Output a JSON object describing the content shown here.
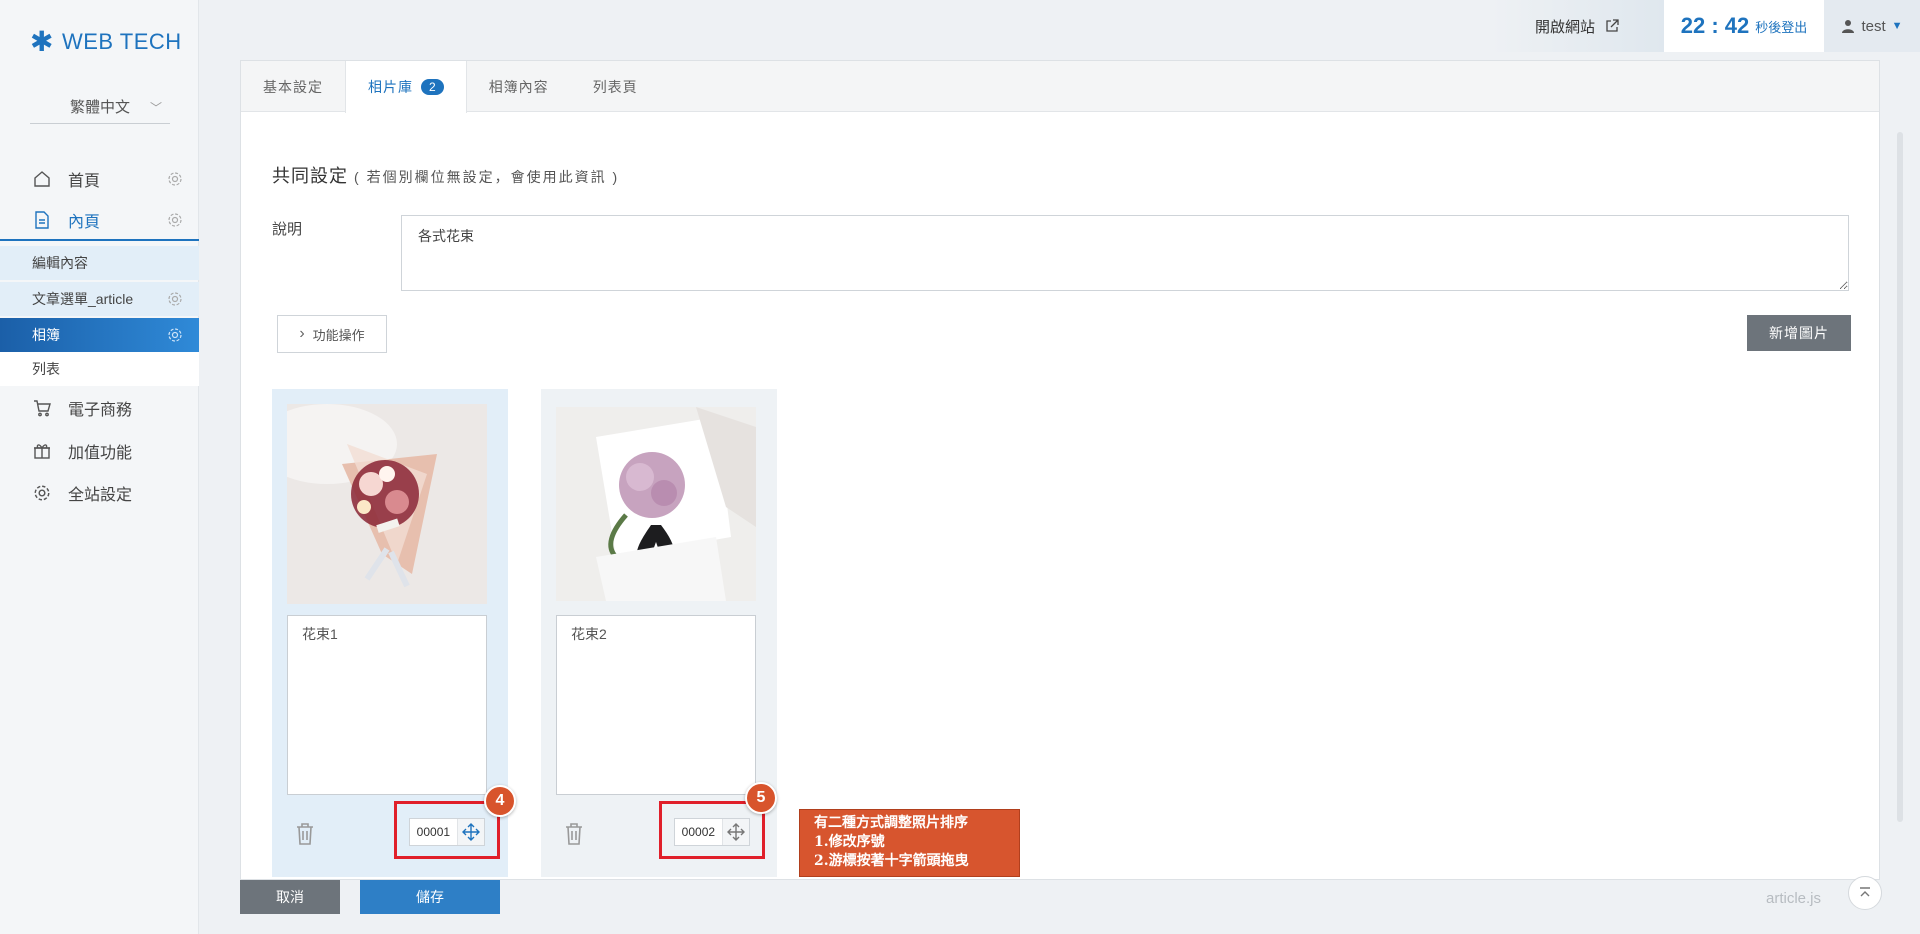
{
  "brand": "WEB TECH",
  "language": "繁體中文",
  "sidebar": {
    "home": "首頁",
    "inner_page": "內頁",
    "sub_items": [
      {
        "label": "編輯內容"
      },
      {
        "label": "文章選單_article"
      },
      {
        "label": "相簿"
      },
      {
        "label": "列表"
      }
    ],
    "ecommerce": "電子商務",
    "addons": "加值功能",
    "site_settings": "全站設定"
  },
  "topbar": {
    "open_site": "開啟網站",
    "timer_value": "22 : 42",
    "timer_label": "秒後登出",
    "user": "test"
  },
  "tabs": [
    {
      "label": "基本設定"
    },
    {
      "label": "相片庫",
      "badge": "2"
    },
    {
      "label": "相簿內容"
    },
    {
      "label": "列表頁"
    }
  ],
  "section": {
    "title": "共同設定",
    "title_note": "( 若個別欄位無設定，會使用此資訊 )",
    "desc_label": "說明",
    "desc_value": "各式花束"
  },
  "actions": {
    "function_ops": "功能操作",
    "add_image": "新增圖片"
  },
  "photos": [
    {
      "caption": "花束1",
      "order": "00001",
      "step": "4"
    },
    {
      "caption": "花束2",
      "order": "00002",
      "step": "5"
    }
  ],
  "note": {
    "line1": "有二種方式調整照片排序",
    "line2": "1.修改序號",
    "line3": "2.游標按著十字箭頭拖曳"
  },
  "footer": {
    "cancel": "取消",
    "save": "儲存",
    "file": "article.js"
  },
  "colors": {
    "brand_blue": "#1e73be",
    "highlight_red": "#e01f2a",
    "note_orange": "#d7552e"
  }
}
